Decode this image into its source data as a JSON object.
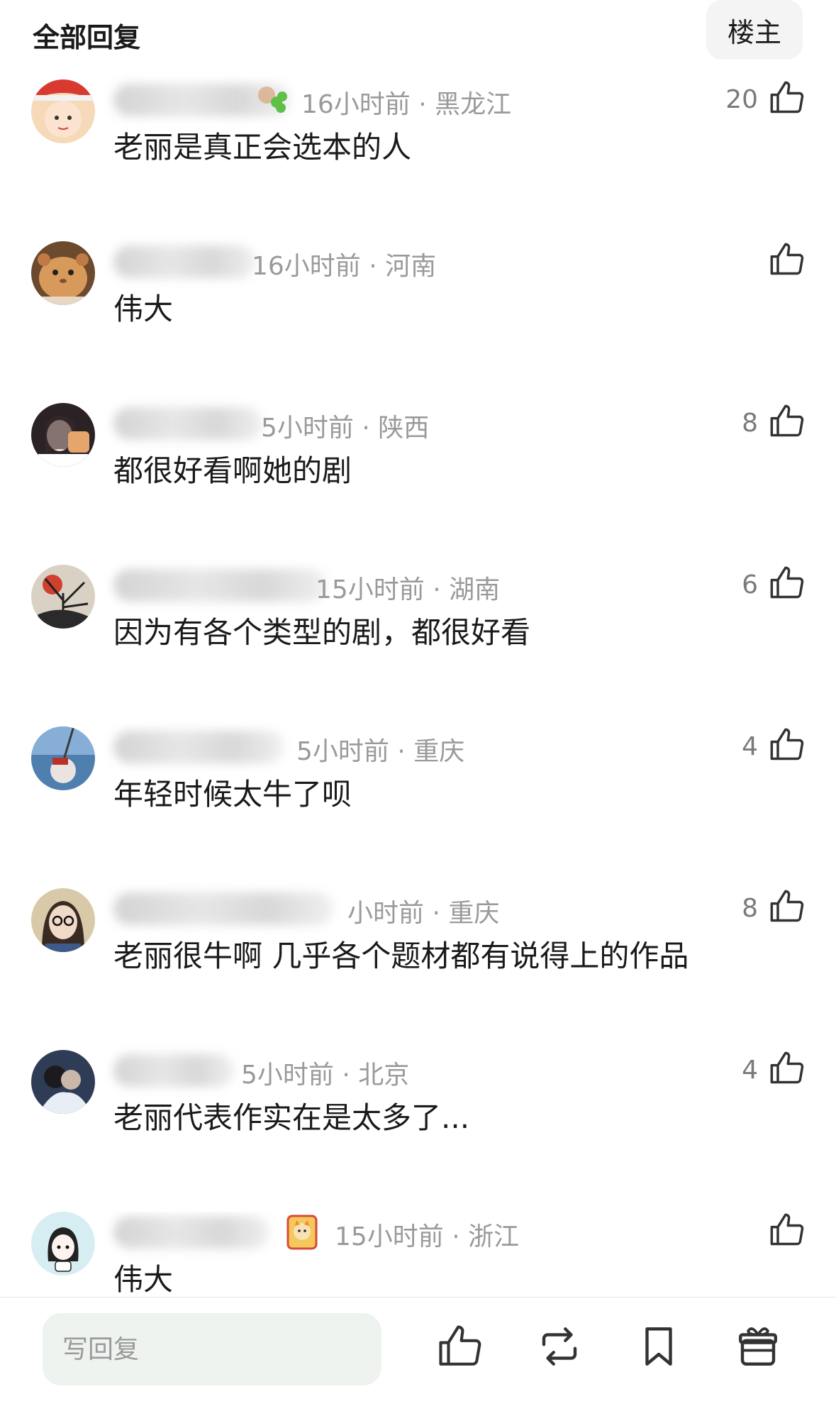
{
  "header": {
    "title": "全部回复",
    "owner_button": "楼主"
  },
  "comments": [
    {
      "time": "16小时前",
      "location": "黑龙江",
      "text": "老丽是真正会选本的人",
      "likes": "20"
    },
    {
      "time": "16小时前",
      "location": "河南",
      "text": "伟大",
      "likes": ""
    },
    {
      "time": "5小时前",
      "location": "陕西",
      "text": "都很好看啊她的剧",
      "likes": "8"
    },
    {
      "time": "15小时前",
      "location": "湖南",
      "text": "因为有各个类型的剧，都很好看",
      "likes": "6"
    },
    {
      "time": "5小时前",
      "location": "重庆",
      "text": "年轻时候太牛了呗",
      "likes": "4"
    },
    {
      "time": "小时前",
      "location": "重庆",
      "text": "老丽很牛啊 几乎各个题材都有说得上的作品",
      "likes": "8"
    },
    {
      "time": "5小时前",
      "location": "北京",
      "text": "老丽代表作实在是太多了...",
      "likes": "4"
    },
    {
      "time": "15小时前",
      "location": "浙江",
      "text": "伟大",
      "likes": ""
    }
  ],
  "bottom_bar": {
    "reply_placeholder": "写回复",
    "icons": [
      "thumb-up-icon",
      "repost-icon",
      "bookmark-icon",
      "gift-icon"
    ]
  },
  "colors": {
    "meta_text": "#9a9a9a",
    "input_bg": "#eef3ef",
    "owner_btn_bg": "#f3f4f3"
  }
}
